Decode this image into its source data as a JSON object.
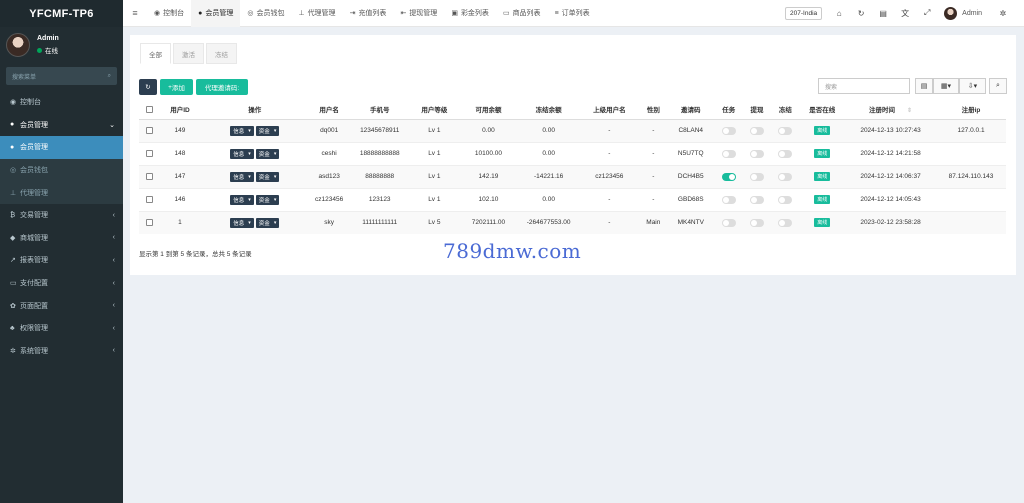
{
  "app": {
    "logo": "YFCMF-TP6"
  },
  "user": {
    "name": "Admin",
    "status": "在线"
  },
  "sidebar": {
    "search_placeholder": "搜索菜单",
    "items": [
      {
        "label": "控制台",
        "icon": "dashboard-icon",
        "glyph": "◉",
        "arrow": ""
      },
      {
        "label": "会员管理",
        "icon": "users-icon",
        "glyph": "●",
        "arrow": "⌄"
      },
      {
        "label": "会员管理",
        "icon": "user-icon",
        "glyph": "●",
        "arrow": ""
      },
      {
        "label": "会员钱包",
        "icon": "wallet-icon",
        "glyph": "◎",
        "arrow": ""
      },
      {
        "label": "代理管理",
        "icon": "sitemap-icon",
        "glyph": "⊥",
        "arrow": ""
      },
      {
        "label": "交易管理",
        "icon": "bitcoin-icon",
        "glyph": "₿",
        "arrow": "‹"
      },
      {
        "label": "商城管理",
        "icon": "tags-icon",
        "glyph": "◆",
        "arrow": "‹"
      },
      {
        "label": "报表管理",
        "icon": "chart-icon",
        "glyph": "↗",
        "arrow": "‹"
      },
      {
        "label": "支付配置",
        "icon": "credit-card-icon",
        "glyph": "▭",
        "arrow": "‹"
      },
      {
        "label": "页面配置",
        "icon": "gear-icon",
        "glyph": "✿",
        "arrow": "‹"
      },
      {
        "label": "权限管理",
        "icon": "group-icon",
        "glyph": "♣",
        "arrow": "‹"
      },
      {
        "label": "系统管理",
        "icon": "cogs-icon",
        "glyph": "✲",
        "arrow": "‹"
      }
    ]
  },
  "topnav": {
    "tabs": [
      {
        "label": "控制台",
        "icon": "dashboard-icon",
        "glyph": "◉"
      },
      {
        "label": "会员管理",
        "icon": "user-icon",
        "glyph": "●"
      },
      {
        "label": "会员钱包",
        "icon": "wallet-icon",
        "glyph": "◎"
      },
      {
        "label": "代理管理",
        "icon": "sitemap-icon",
        "glyph": "⊥"
      },
      {
        "label": "充值列表",
        "icon": "sign-in-icon",
        "glyph": "⇥"
      },
      {
        "label": "提现管理",
        "icon": "sign-out-icon",
        "glyph": "⇤"
      },
      {
        "label": "彩金列表",
        "icon": "gift-icon",
        "glyph": "▣"
      },
      {
        "label": "商品列表",
        "icon": "desktop-icon",
        "glyph": "▭"
      },
      {
        "label": "订单列表",
        "icon": "list-icon",
        "glyph": "≡"
      }
    ],
    "region": "207-India",
    "admin": "Admin"
  },
  "subtabs": [
    "全部",
    "激活",
    "冻结"
  ],
  "toolbar": {
    "add": "添加",
    "code": "代理邀请码:"
  },
  "table": {
    "search_placeholder": "搜索",
    "columns": [
      "用户ID",
      "操作",
      "用户名",
      "手机号",
      "用户等级",
      "可用余额",
      "冻结余额",
      "上级用户名",
      "性别",
      "邀请码",
      "任务",
      "提现",
      "冻结",
      "是否在线",
      "注册时间",
      "注册ip"
    ],
    "op_info": "信息",
    "op_funds": "资金",
    "online_label": "离线",
    "rows": [
      {
        "id": "149",
        "username": "dq001",
        "phone": "12345678911",
        "level": "Lv 1",
        "balance": "0.00",
        "frozen": "0.00",
        "parent": "-",
        "gender": "-",
        "code": "C8LAN4",
        "task": false,
        "withdraw": false,
        "freeze": false,
        "time": "2024-12-13 10:27:43",
        "ip": "127.0.0.1"
      },
      {
        "id": "148",
        "username": "ceshi",
        "phone": "18888888888",
        "level": "Lv 1",
        "balance": "10100.00",
        "frozen": "0.00",
        "parent": "-",
        "gender": "-",
        "code": "N5U7TQ",
        "task": false,
        "withdraw": false,
        "freeze": false,
        "time": "2024-12-12 14:21:58",
        "ip": ""
      },
      {
        "id": "147",
        "username": "asd123",
        "phone": "88888888",
        "level": "Lv 1",
        "balance": "142.19",
        "frozen": "-14221.16",
        "parent": "cz123456",
        "gender": "-",
        "code": "DCH4B5",
        "task": true,
        "withdraw": false,
        "freeze": false,
        "time": "2024-12-12 14:06:37",
        "ip": "87.124.110.143"
      },
      {
        "id": "146",
        "username": "cz123456",
        "phone": "123123",
        "level": "Lv 1",
        "balance": "102.10",
        "frozen": "0.00",
        "parent": "-",
        "gender": "-",
        "code": "GBD68S",
        "task": false,
        "withdraw": false,
        "freeze": false,
        "time": "2024-12-12 14:05:43",
        "ip": ""
      },
      {
        "id": "1",
        "username": "sky",
        "phone": "11111111111",
        "level": "Lv 5",
        "balance": "7202111.00",
        "frozen": "-264677553.00",
        "parent": "-",
        "gender": "Main",
        "code": "MK4NTV",
        "task": false,
        "withdraw": false,
        "freeze": false,
        "time": "2023-02-12 23:58:28",
        "ip": ""
      }
    ],
    "footer": "显示第 1 到第 5 条记录，总共 5 条记录"
  },
  "watermark": "789dmw.com"
}
